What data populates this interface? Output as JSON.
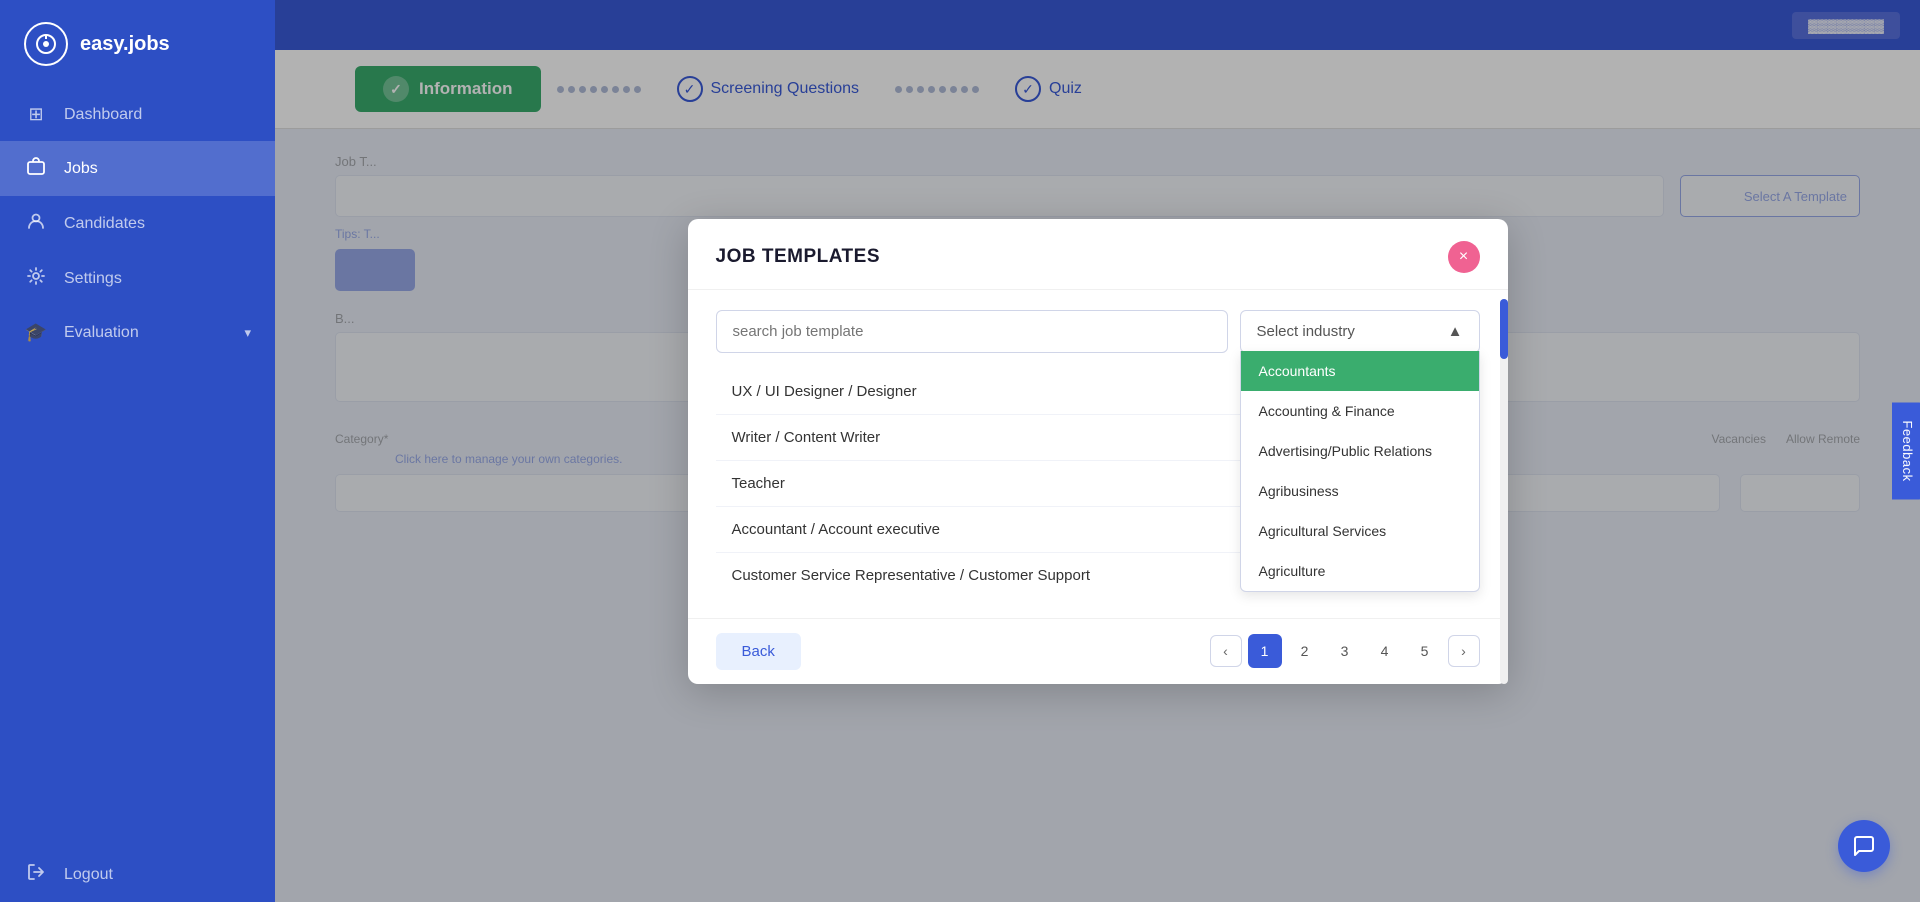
{
  "sidebar": {
    "logo_text": "easy.jobs",
    "nav_items": [
      {
        "id": "dashboard",
        "label": "Dashboard",
        "icon": "⊞"
      },
      {
        "id": "jobs",
        "label": "Jobs",
        "icon": "💼",
        "active": true
      },
      {
        "id": "candidates",
        "label": "Candidates",
        "icon": "👤"
      },
      {
        "id": "settings",
        "label": "Settings",
        "icon": "⚙"
      },
      {
        "id": "evaluation",
        "label": "Evaluation",
        "icon": "🎓",
        "has_chevron": true
      }
    ],
    "logout_label": "Logout"
  },
  "wizard": {
    "steps": [
      {
        "id": "information",
        "label": "Information",
        "state": "active"
      },
      {
        "id": "screening",
        "label": "Screening Questions",
        "state": "done"
      },
      {
        "id": "quiz",
        "label": "Quiz",
        "state": "done"
      }
    ]
  },
  "page": {
    "select_template_label": "Select A Template",
    "tips_label": "Tips: T",
    "job_title_label": "Job T"
  },
  "modal": {
    "title": "JOB TEMPLATES",
    "close_label": "×",
    "search_placeholder": "search job template",
    "industry_placeholder": "Select industry",
    "job_items": [
      "UX / UI Designer / Designer",
      "Writer / Content Writer",
      "Teacher",
      "Accountant / Account executive",
      "Customer Service Representative / Customer Support"
    ],
    "industry_options": [
      {
        "id": "accountants",
        "label": "Accountants",
        "selected": true
      },
      {
        "id": "accounting-finance",
        "label": "Accounting & Finance",
        "selected": false
      },
      {
        "id": "advertising",
        "label": "Advertising/Public Relations",
        "selected": false
      },
      {
        "id": "agribusiness",
        "label": "Agribusiness",
        "selected": false
      },
      {
        "id": "agricultural-services",
        "label": "Agricultural Services",
        "selected": false
      },
      {
        "id": "agriculture",
        "label": "Agriculture",
        "selected": false
      }
    ],
    "back_label": "Back",
    "pagination": {
      "pages": [
        "1",
        "2",
        "3",
        "4",
        "5"
      ],
      "active_page": "1"
    }
  },
  "feedback_label": "Feedback",
  "chat_icon": "💬"
}
